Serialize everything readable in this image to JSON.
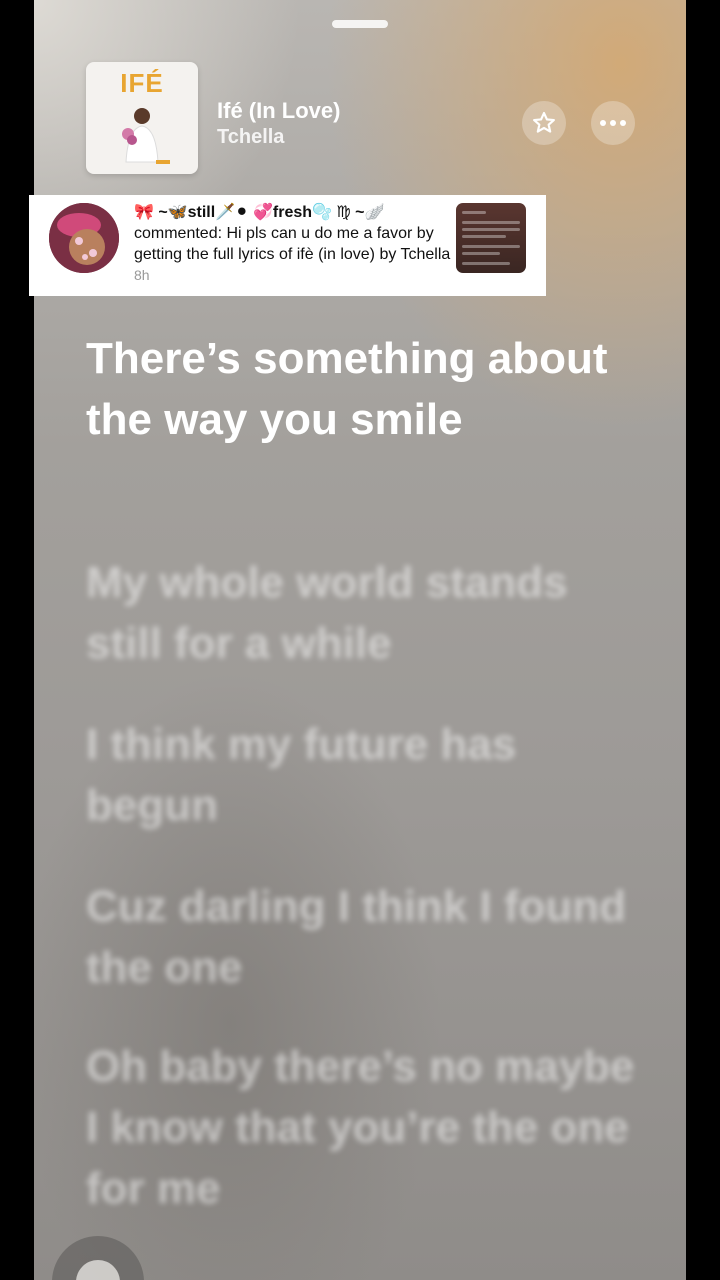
{
  "player": {
    "artwork_title": "IFÉ",
    "title": "Ifé (In Love)",
    "artist": "Tchella"
  },
  "comment": {
    "user": "🎀 ~🦋still🗡️⚫ 💞fresh🫧 ♍ ~🪽",
    "text": "commented: Hi pls can u do me a favor by getting the full lyrics of ifè (in love) by Tchella",
    "time": "8h"
  },
  "lyrics": [
    "There’s something about the way you smile",
    "My whole world stands still for a while",
    "I think my future has begun",
    "Cuz darling I think I found the one",
    "Oh baby there’s no maybe I know that you’re the one for me"
  ],
  "colors": {
    "accent": "#e8a531",
    "background": "#a3a09c"
  },
  "icons": {
    "favorite": "star-icon",
    "more": "ellipsis-icon"
  }
}
